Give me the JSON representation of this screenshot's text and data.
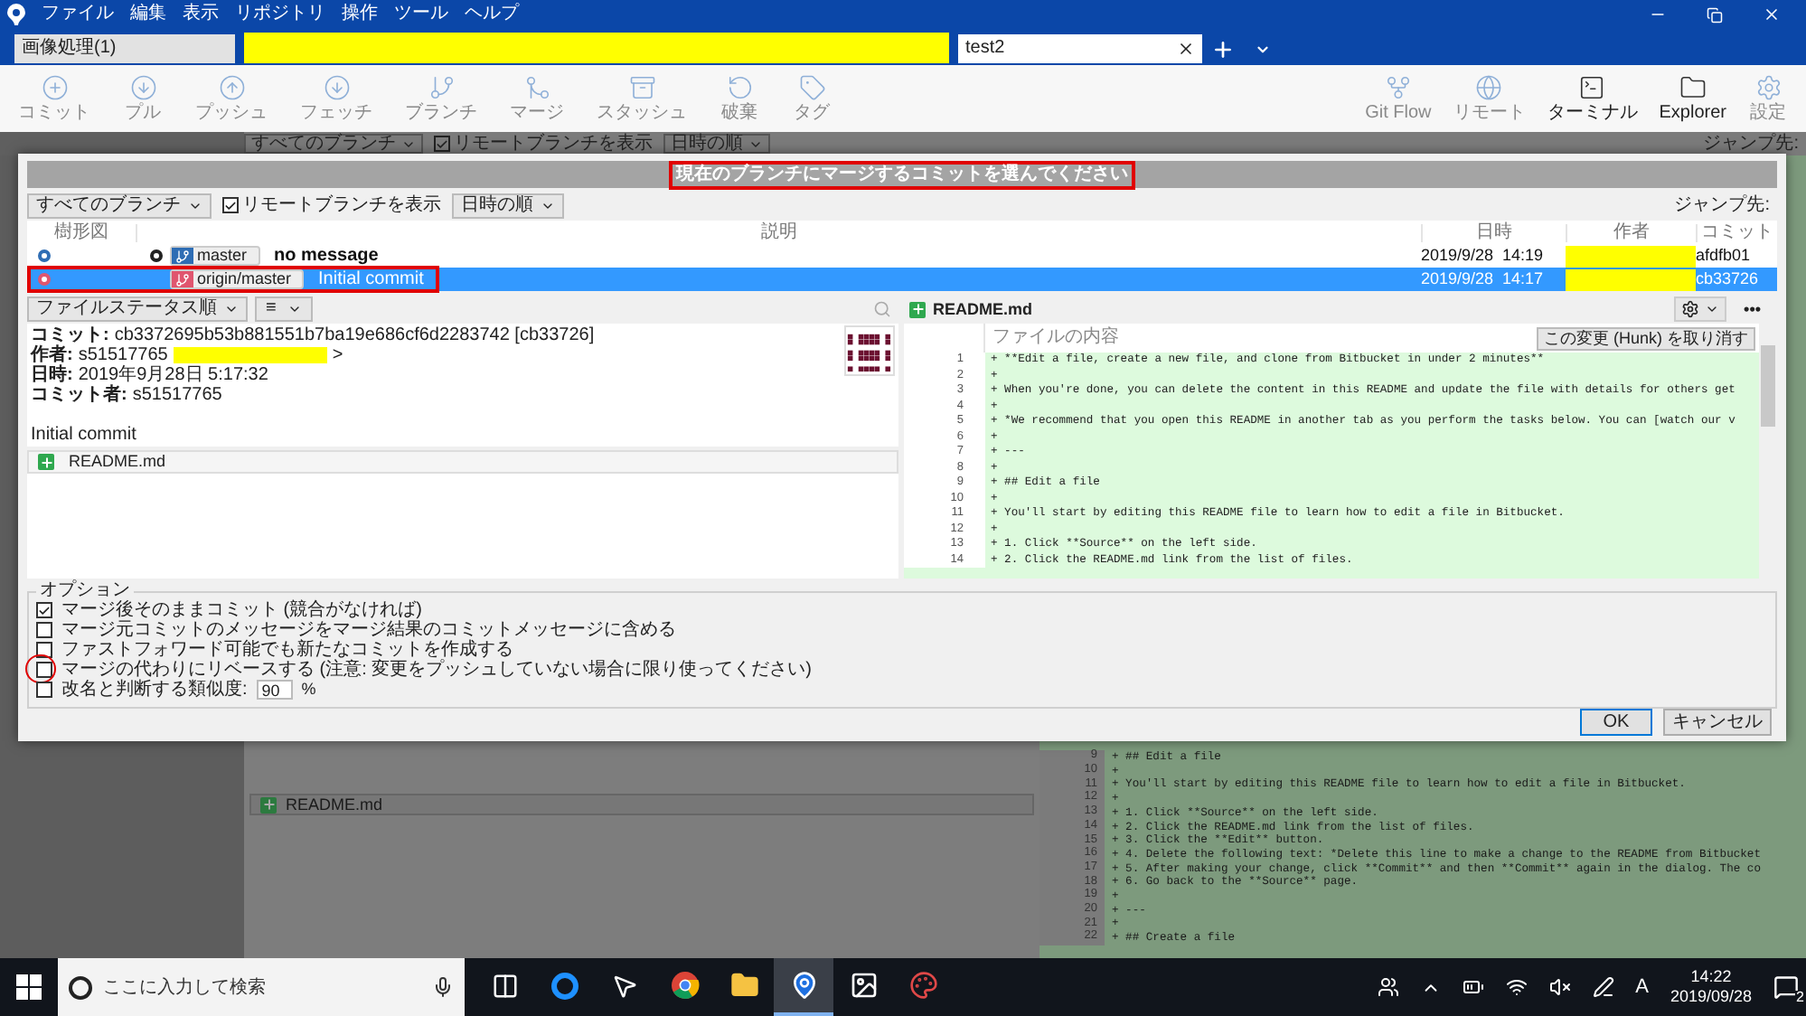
{
  "menu_bar": {
    "items": [
      "ファイル",
      "編集",
      "表示",
      "リポジトリ",
      "操作",
      "ツール",
      "ヘルプ"
    ]
  },
  "tabs": [
    {
      "label": "画像処理(1)",
      "selected": false,
      "redacted_after": true
    },
    {
      "label": "test2",
      "selected": true
    }
  ],
  "toolbar": {
    "left": [
      {
        "label": "コミット",
        "kind": "commit",
        "disabled": true
      },
      {
        "label": "プル",
        "kind": "pull",
        "disabled": true
      },
      {
        "label": "プッシュ",
        "kind": "push",
        "disabled": true
      },
      {
        "label": "フェッチ",
        "kind": "fetch",
        "disabled": true
      },
      {
        "label": "ブランチ",
        "kind": "branch",
        "disabled": true
      },
      {
        "label": "マージ",
        "kind": "merge",
        "disabled": true
      },
      {
        "label": "スタッシュ",
        "kind": "stash",
        "disabled": true
      },
      {
        "label": "破棄",
        "kind": "discard",
        "disabled": true
      },
      {
        "label": "タグ",
        "kind": "tag",
        "disabled": true
      }
    ],
    "right": [
      {
        "label": "Git Flow",
        "kind": "gitflow",
        "disabled": true
      },
      {
        "label": "リモート",
        "kind": "remote",
        "disabled": true
      },
      {
        "label": "ターミナル",
        "kind": "terminal",
        "disabled": false
      },
      {
        "label": "Explorer",
        "kind": "explorer",
        "disabled": false
      },
      {
        "label": "設定",
        "kind": "settings",
        "disabled": true
      }
    ]
  },
  "background": {
    "filter_bar": {
      "branches": "すべてのブランチ",
      "remote_label": "リモートブランチを表示",
      "remote_checked": true,
      "sort": "日時の順",
      "jump_label": "ジャンプ先:"
    },
    "file_row": "README.md",
    "diff_lines": [
      {
        "number": "9",
        "text": "+ ## Edit a file"
      },
      {
        "number": "10",
        "text": "+"
      },
      {
        "number": "11",
        "text": "+ You'll start by editing this README file to learn how to edit a file in Bitbucket."
      },
      {
        "number": "12",
        "text": "+"
      },
      {
        "number": "13",
        "text": "+ 1. Click **Source** on the left side."
      },
      {
        "number": "14",
        "text": "+ 2. Click the README.md link from the list of files."
      },
      {
        "number": "15",
        "text": "+ 3. Click the **Edit** button."
      },
      {
        "number": "16",
        "text": "+ 4. Delete the following text: *Delete this line to make a change to the README from Bitbucket"
      },
      {
        "number": "17",
        "text": "+ 5. After making your change, click **Commit** and then **Commit** again in the dialog. The co"
      },
      {
        "number": "18",
        "text": "+ 6. Go back to the **Source** page."
      },
      {
        "number": "19",
        "text": "+"
      },
      {
        "number": "20",
        "text": "+ ---"
      },
      {
        "number": "21",
        "text": "+"
      },
      {
        "number": "22",
        "text": "+ ## Create a file"
      }
    ]
  },
  "dialog": {
    "title": "現在のブランチにマージするコミットを選んでください",
    "title_annotated": true,
    "filter_bar": {
      "branches": "すべてのブランチ",
      "remote_label": "リモートブランチを表示",
      "remote_checked": true,
      "sort": "日時の順",
      "jump_label": "ジャンプ先:"
    },
    "table": {
      "columns": [
        "樹形図",
        "説明",
        "日時",
        "作者",
        "コミット"
      ],
      "rows": [
        {
          "branch": "master",
          "color": "#2e6db4",
          "head": true,
          "message": "no message",
          "date": "2019/9/28  14:19",
          "author_redacted": true,
          "commit": "afdfb01",
          "selected": false
        },
        {
          "branch": "origin/master",
          "color": "#e0566f",
          "message": "Initial commit",
          "date": "2019/9/28  14:17",
          "author_redacted": true,
          "commit": "cb33726",
          "selected": true,
          "annotated": true
        }
      ]
    },
    "file_bar": {
      "sort": "ファイルステータス順",
      "view": "≡"
    },
    "commit_info": [
      {
        "label": "コミット:",
        "value": "cb3372695b53b881551b7ba19e686cf6d2283742 [cb33726]"
      },
      {
        "label": "作者:",
        "value": "s51517765",
        "redacted": true,
        "tail": ">"
      },
      {
        "label": "日時:",
        "value": "2019年9月28日 5:17:32"
      },
      {
        "label": "コミット者:",
        "value": "s51517765"
      }
    ],
    "message": "Initial commit",
    "files": [
      {
        "name": "README.md"
      }
    ],
    "diff": {
      "file": "README.md",
      "more": "•••",
      "column": "ファイルの内容",
      "hunk_button": "この変更 (Hunk) を取り消す",
      "lines": [
        {
          "number": "1",
          "text": "+ **Edit a file, create a new file, and clone from Bitbucket in under 2 minutes**"
        },
        {
          "number": "2",
          "text": "+"
        },
        {
          "number": "3",
          "text": "+ When you're done, you can delete the content in this README and update the file with details for others get"
        },
        {
          "number": "4",
          "text": "+"
        },
        {
          "number": "5",
          "text": "+ *We recommend that you open this README in another tab as you perform the tasks below. You can [watch our v"
        },
        {
          "number": "6",
          "text": "+"
        },
        {
          "number": "7",
          "text": "+ ---"
        },
        {
          "number": "8",
          "text": "+"
        },
        {
          "number": "9",
          "text": "+ ## Edit a file"
        },
        {
          "number": "10",
          "text": "+"
        },
        {
          "number": "11",
          "text": "+ You'll start by editing this README file to learn how to edit a file in Bitbucket."
        },
        {
          "number": "12",
          "text": "+"
        },
        {
          "number": "13",
          "text": "+ 1. Click **Source** on the left side."
        },
        {
          "number": "14",
          "text": "+ 2. Click the README.md link from the list of files."
        }
      ]
    },
    "options": {
      "legend": "オプション",
      "items": [
        {
          "label": "マージ後そのままコミット (競合がなければ)",
          "checked": true
        },
        {
          "label": "マージ元コミットのメッセージをマージ結果のコミットメッセージに含める",
          "checked": false
        },
        {
          "label": "ファストフォワード可能でも新たなコミットを作成する",
          "checked": false
        },
        {
          "label": "マージの代わりにリベースする (注意: 変更をプッシュしていない場合に限り使ってください)",
          "checked": false,
          "annotated": true
        },
        {
          "label": "改名と判断する類似度:",
          "checked": false,
          "value": "90",
          "unit": "%"
        }
      ]
    },
    "buttons": [
      {
        "label": "OK",
        "default": true
      },
      {
        "label": "キャンセル",
        "default": false
      }
    ]
  },
  "taskbar": {
    "search_placeholder": "ここに入力して検索",
    "apps": [
      {
        "kind": "taskview",
        "active": false
      },
      {
        "kind": "edge",
        "active": false
      },
      {
        "kind": "cursor",
        "active": false
      },
      {
        "kind": "chrome",
        "active": false
      },
      {
        "kind": "folder",
        "active": false
      },
      {
        "kind": "sourcetree",
        "active": true
      },
      {
        "kind": "photos",
        "active": false
      },
      {
        "kind": "paint",
        "active": false
      }
    ],
    "ime": "A",
    "time": "14:22",
    "date": "2019/09/28",
    "notifications": "2"
  }
}
